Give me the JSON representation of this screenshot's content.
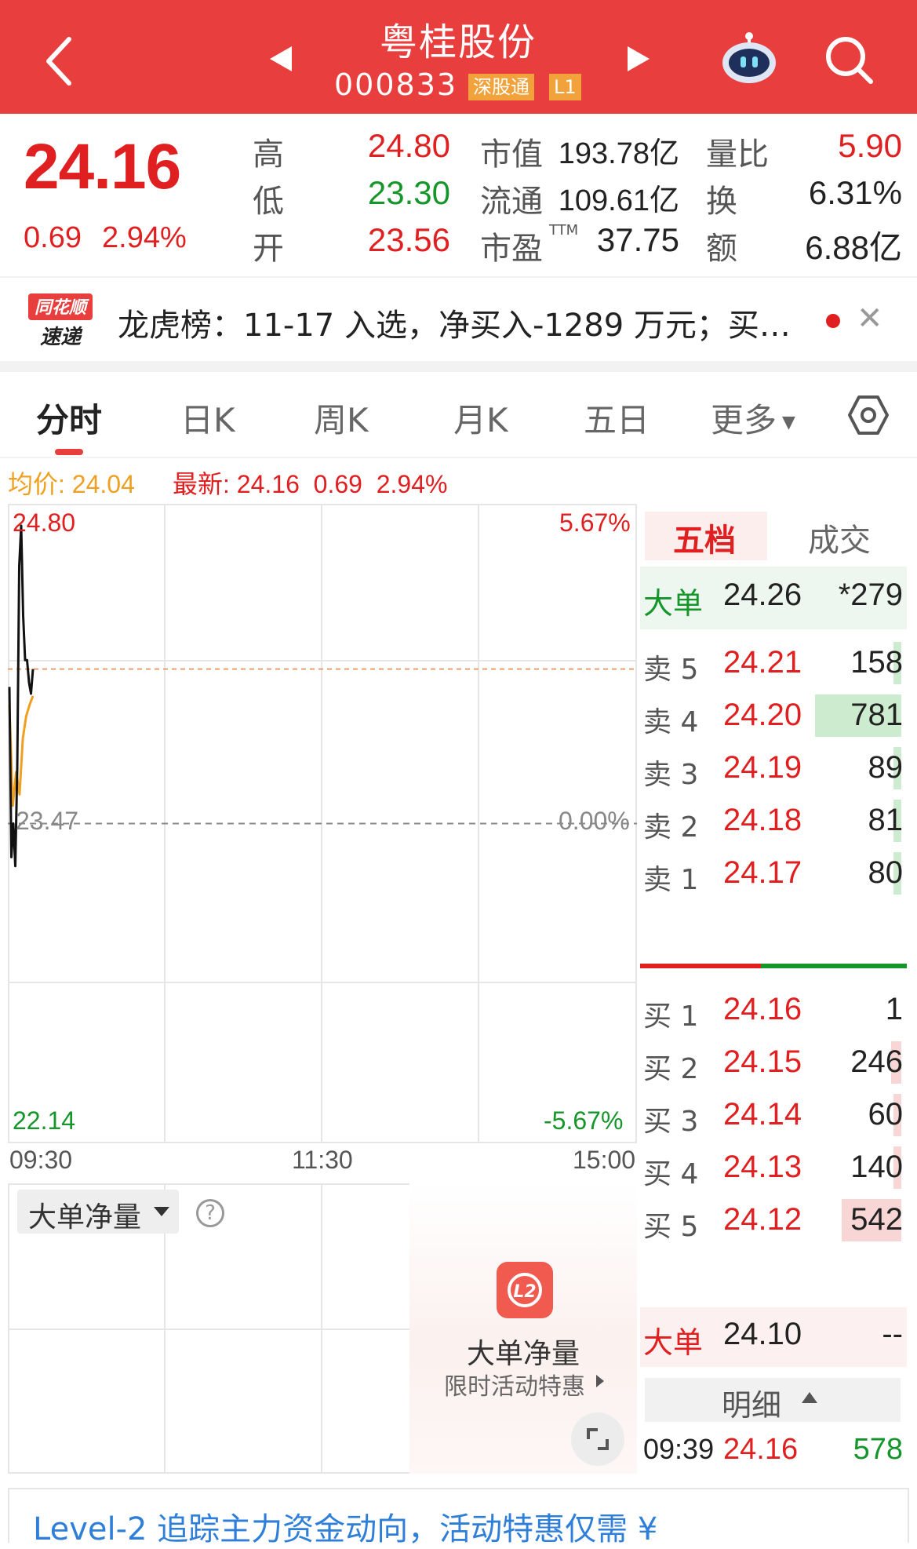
{
  "header": {
    "title": "粤桂股份",
    "code": "000833",
    "badges": [
      "深股通",
      "L1"
    ]
  },
  "quote": {
    "price": "24.16",
    "change": "0.69",
    "change_pct": "2.94%",
    "high_label": "高",
    "high": "24.80",
    "low_label": "低",
    "low": "23.30",
    "open_label": "开",
    "open": "23.56",
    "mktcap_label": "市值",
    "mktcap": "193.78亿",
    "float_label": "流通",
    "float": "109.61亿",
    "pe_label": "市盈",
    "pe_sup": "TTM",
    "pe": "37.75",
    "volratio_label": "量比",
    "volratio": "5.90",
    "turnover_label": "换",
    "turnover": "6.31%",
    "amount_label": "额",
    "amount": "6.88亿"
  },
  "news": {
    "logo_line1": "同花顺",
    "logo_line2": "速递",
    "text": "龙虎榜：11-17 入选，净买入-1289 万元；买…"
  },
  "tabs": [
    "分时",
    "日K",
    "周K",
    "月K",
    "五日",
    "更多"
  ],
  "info_line": {
    "avg_label": "均价:",
    "avg": "24.04",
    "latest_label": "最新:",
    "latest": "24.16",
    "change": "0.69",
    "change_pct": "2.94%"
  },
  "chart_data": {
    "type": "line",
    "title": "",
    "y_left_labels": [
      "24.80",
      "23.47",
      "22.14"
    ],
    "y_right_labels": [
      "5.67%",
      "0.00%",
      "-5.67%"
    ],
    "x_labels": [
      "09:30",
      "11:30",
      "15:00"
    ],
    "ylim": [
      22.14,
      24.8
    ],
    "prev_close": 23.47,
    "series": [
      {
        "values": [
          24.08,
          23.32,
          23.47,
          23.28,
          23.72,
          24.62,
          24.8,
          24.4,
          24.2,
          24.2,
          24.1,
          24.05,
          24.16
        ]
      },
      {
        "values": [
          24.0,
          23.55,
          23.7,
          23.6,
          23.85,
          23.95,
          24.0,
          24.04
        ]
      }
    ],
    "colors": {
      "price": "#111111",
      "avg": "#f0a020",
      "current_line": "#e8a070"
    }
  },
  "lower_pane": {
    "indicator": "大单净量",
    "promo_title": "大单净量",
    "promo_sub": "限时活动特惠"
  },
  "orderbook": {
    "tabs": [
      "五档",
      "成交"
    ],
    "big_top": {
      "label": "大单",
      "price": "24.26",
      "vol": "*279"
    },
    "asks": [
      {
        "label": "卖 5",
        "price": "24.21",
        "vol": "158",
        "bar": 0.08
      },
      {
        "label": "卖 4",
        "price": "24.20",
        "vol": "781",
        "bar": 1.0
      },
      {
        "label": "卖 3",
        "price": "24.19",
        "vol": "89",
        "bar": 0.04
      },
      {
        "label": "卖 2",
        "price": "24.18",
        "vol": "81",
        "bar": 0.04
      },
      {
        "label": "卖 1",
        "price": "24.17",
        "vol": "80",
        "bar": 0.04
      }
    ],
    "bids": [
      {
        "label": "买 1",
        "price": "24.16",
        "vol": "1",
        "bar": 0.0
      },
      {
        "label": "买 2",
        "price": "24.15",
        "vol": "246",
        "bar": 0.12
      },
      {
        "label": "买 3",
        "price": "24.14",
        "vol": "60",
        "bar": 0.03
      },
      {
        "label": "买 4",
        "price": "24.13",
        "vol": "140",
        "bar": 0.07
      },
      {
        "label": "买 5",
        "price": "24.12",
        "vol": "542",
        "bar": 0.69
      }
    ],
    "big_bottom": {
      "label": "大单",
      "price": "24.10",
      "vol": "--"
    },
    "detail_label": "明细",
    "tick": {
      "time": "09:39",
      "price": "24.16",
      "vol": "578"
    }
  },
  "banner": {
    "text": "Level-2 追踪主力资金动向，活动特惠仅需 ¥"
  },
  "colors": {
    "header_red": "#e93e3e",
    "up_red": "#e02020",
    "down_green": "#15962b",
    "avg_orange": "#f0a020"
  }
}
